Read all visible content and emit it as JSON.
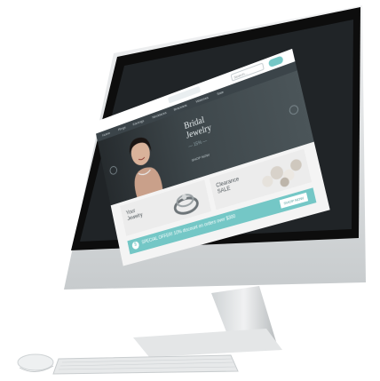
{
  "site": {
    "search_placeholder": "Search...",
    "nav": [
      "Home",
      "Rings",
      "Earrings",
      "Necklaces",
      "Bracelets",
      "Watches",
      "Sale"
    ],
    "hero": {
      "title_line1": "Bridal",
      "title_line2": "Jewelry",
      "subtitle": "— 15% —",
      "link": "SHOP NOW"
    },
    "promos": [
      {
        "title_line1": "Your",
        "title_line2": "Jewelry"
      },
      {
        "title_line1": "Clearance",
        "title_line2": "SALE"
      }
    ],
    "banner": {
      "text": "SPECIAL OFFER! 10% discount on orders over $300",
      "button": "SHOP NOW"
    }
  },
  "colors": {
    "accent": "#74c7c6",
    "hero_dark": "#262b2e",
    "nav": "#3b4449",
    "monitor_silver": "#d9dcde",
    "bezel": "#0d0d0d"
  },
  "icons": [
    "monitor-stand",
    "keyboard",
    "mouse",
    "cart-icon",
    "tag-icon",
    "arrow-left-icon",
    "arrow-right-icon"
  ]
}
